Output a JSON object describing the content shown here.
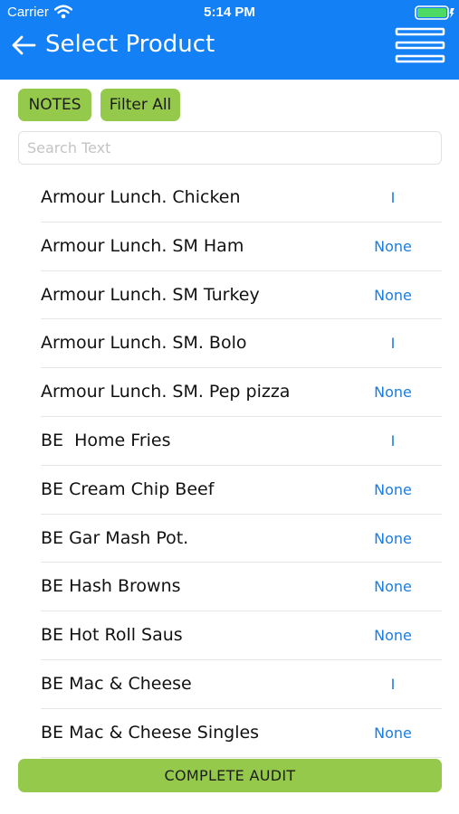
{
  "status_bar": {
    "carrier": "Carrier",
    "time": "5:14 PM"
  },
  "header": {
    "title": "Select Product",
    "back_icon": "arrow-left-icon",
    "menu_icon": "hamburger-menu-icon"
  },
  "toolbar": {
    "notes_label": "NOTES",
    "filter_label": "Filter All"
  },
  "search": {
    "placeholder": "Search Text",
    "value": ""
  },
  "products": [
    {
      "name": "Armour Lunch. Chicken",
      "value": "I"
    },
    {
      "name": "Armour Lunch. SM Ham",
      "value": "None"
    },
    {
      "name": "Armour Lunch. SM Turkey",
      "value": "None"
    },
    {
      "name": "Armour Lunch. SM. Bolo",
      "value": "I"
    },
    {
      "name": "Armour Lunch. SM. Pep pizza",
      "value": "None"
    },
    {
      "name": "BE  Home Fries",
      "value": "I"
    },
    {
      "name": "BE Cream Chip Beef",
      "value": "None"
    },
    {
      "name": "BE Gar Mash Pot.",
      "value": "None"
    },
    {
      "name": "BE Hash Browns",
      "value": "None"
    },
    {
      "name": "BE Hot Roll Saus",
      "value": "None"
    },
    {
      "name": "BE Mac & Cheese",
      "value": "I"
    },
    {
      "name": "BE Mac & Cheese Singles",
      "value": "None"
    }
  ],
  "footer": {
    "complete_label": "COMPLETE AUDIT"
  },
  "colors": {
    "header_blue": "#1480f5",
    "button_green": "#95c94c",
    "value_blue": "#1a7de0"
  }
}
